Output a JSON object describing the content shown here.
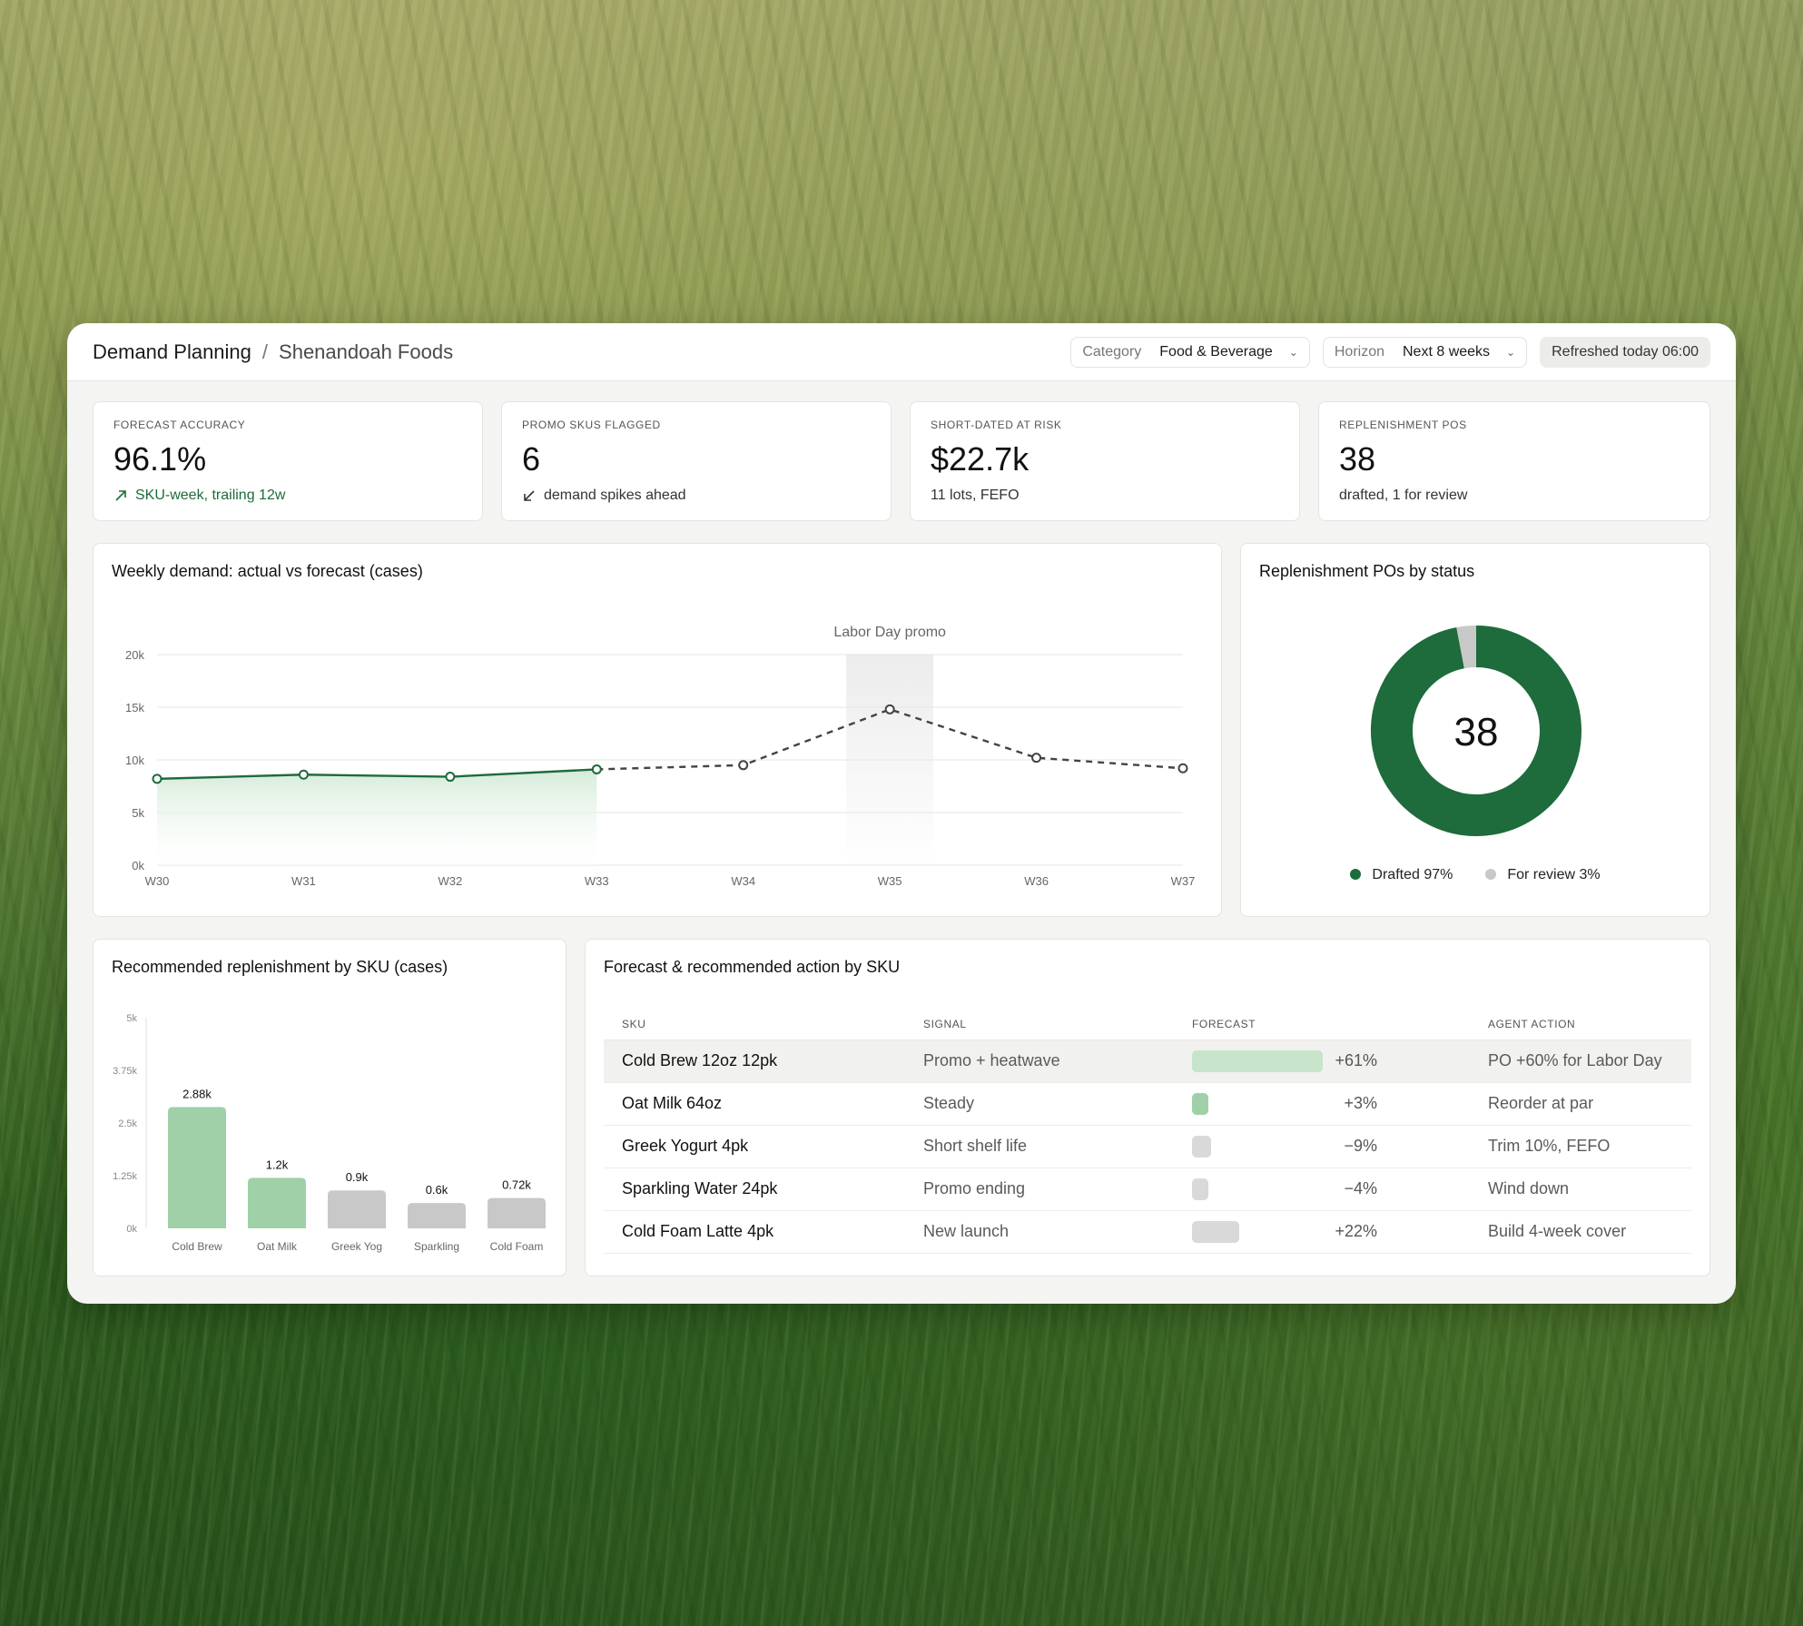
{
  "header": {
    "crumb_app": "Demand Planning",
    "crumb_sep": "/",
    "crumb_org": "Shenandoah Foods",
    "category": {
      "label": "Category",
      "value": "Food & Beverage"
    },
    "horizon": {
      "label": "Horizon",
      "value": "Next 8 weeks"
    },
    "refreshed": "Refreshed today 06:00"
  },
  "kpis": [
    {
      "label": "FORECAST ACCURACY",
      "value": "96.1%",
      "sub": "SKU-week, trailing 12w",
      "icon": "arrow-up-right-icon"
    },
    {
      "label": "PROMO SKUS FLAGGED",
      "value": "6",
      "sub": "demand spikes ahead",
      "icon": "arrow-down-left-icon"
    },
    {
      "label": "SHORT-DATED AT RISK",
      "value": "$22.7k",
      "sub": "11 lots, FEFO"
    },
    {
      "label": "REPLENISHMENT POS",
      "value": "38",
      "sub": "drafted, 1 for review"
    }
  ],
  "colors": {
    "green": "#1e6b3c",
    "light_green": "#9fd0a8",
    "gray": "#c8c8c8",
    "pale_gray": "#e4e4e4"
  },
  "chart_data": [
    {
      "type": "line",
      "title": "Weekly demand: actual vs forecast (cases)",
      "x": [
        "W30",
        "W31",
        "W32",
        "W33",
        "W34",
        "W35",
        "W36",
        "W37"
      ],
      "y_ticks": [
        "0k",
        "5k",
        "10k",
        "15k",
        "20k"
      ],
      "ylim": [
        0,
        20000
      ],
      "annotation": "Labor Day promo",
      "annotation_x": "W35",
      "series": [
        {
          "values": [
            8200,
            8600,
            8400,
            9100,
            null,
            null,
            null,
            null
          ],
          "style": "solid"
        },
        {
          "values": [
            null,
            null,
            null,
            9100,
            9500,
            14800,
            10200,
            9200
          ],
          "style": "dashed"
        }
      ]
    },
    {
      "type": "pie",
      "title": "Replenishment POs by status",
      "center_label": "38",
      "slices": [
        {
          "name": "Drafted",
          "value": 97,
          "label": "Drafted 97%"
        },
        {
          "name": "For review",
          "value": 3,
          "label": "For review 3%"
        }
      ]
    },
    {
      "type": "bar",
      "title": "Recommended replenishment by SKU (cases)",
      "categories": [
        "Cold Brew",
        "Oat Milk",
        "Greek Yog",
        "Sparkling",
        "Cold Foam"
      ],
      "values": [
        2880,
        1200,
        900,
        600,
        720
      ],
      "value_labels": [
        "2.88k",
        "1.2k",
        "0.9k",
        "0.6k",
        "0.72k"
      ],
      "y_ticks": [
        "0k",
        "1.25k",
        "2.5k",
        "3.75k",
        "5k"
      ],
      "ylim": [
        0,
        5000
      ],
      "bar_colors": [
        "#9fd0a8",
        "#9fd0a8",
        "#c8c8c8",
        "#c8c8c8",
        "#c8c8c8"
      ]
    }
  ],
  "table": {
    "title": "Forecast & recommended action by SKU",
    "columns": [
      "SKU",
      "SIGNAL",
      "FORECAST",
      "AGENT ACTION"
    ],
    "rows": [
      {
        "sku": "Cold Brew 12oz 12pk",
        "signal": "Promo + heatwave",
        "forecast": "+61%",
        "change": 61,
        "action": "PO +60% for Labor Day"
      },
      {
        "sku": "Oat Milk 64oz",
        "signal": "Steady",
        "forecast": "+3%",
        "change": 3,
        "action": "Reorder at par"
      },
      {
        "sku": "Greek Yogurt 4pk",
        "signal": "Short shelf life",
        "forecast": "−9%",
        "change": -9,
        "action": "Trim 10%, FEFO"
      },
      {
        "sku": "Sparkling Water 24pk",
        "signal": "Promo ending",
        "forecast": "−4%",
        "change": -4,
        "action": "Wind down"
      },
      {
        "sku": "Cold Foam Latte 4pk",
        "signal": "New launch",
        "forecast": "+22%",
        "change": 22,
        "action": "Build 4-week cover"
      }
    ]
  }
}
